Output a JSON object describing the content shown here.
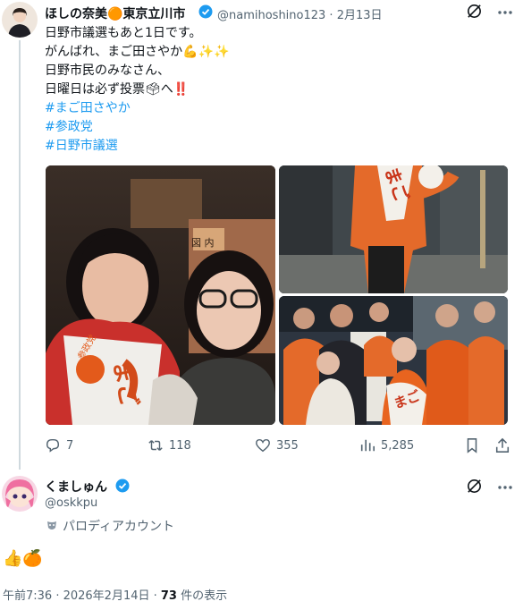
{
  "tweet1": {
    "author_name": "ほしの奈美🟠東京立川市",
    "handle_time": "@namihoshino123 · 2月13日",
    "lines": [
      "日野市議選もあと1日です。",
      "がんばれ、まご田さやか💪✨✨",
      "日野市民のみなさん、",
      "日曜日は必ず投票🗳へ‼️"
    ],
    "hashtags": [
      "#まご田さやか",
      "#参政党",
      "#日野市議選"
    ],
    "photos": [
      {
        "sign": "図 内",
        "sash": "まご",
        "badge": "参政党"
      },
      {
        "sash": "まご"
      },
      {
        "sash": "まご"
      }
    ],
    "metrics": {
      "replies": "7",
      "reposts": "118",
      "likes": "355",
      "views": "5,285"
    }
  },
  "tweet2": {
    "author_name": "くましゅん",
    "handle": "@oskkpu",
    "parody_label": "パロディアカウント",
    "body": "👍🍊",
    "footer_time": "午前7:36 · 2026年2月14日 · ",
    "footer_views_num": "73",
    "footer_views_label": " 件の表示"
  },
  "colors": {
    "accent": "#1d9bf0",
    "muted": "#536471",
    "verified": "#1d9bf0",
    "orange": "#f57c1f"
  },
  "icons": [
    "verified-badge-icon",
    "grok-icon",
    "reply-icon",
    "repost-icon",
    "like-icon",
    "views-icon",
    "bookmark-icon",
    "share-icon",
    "parody-mask-icon"
  ]
}
